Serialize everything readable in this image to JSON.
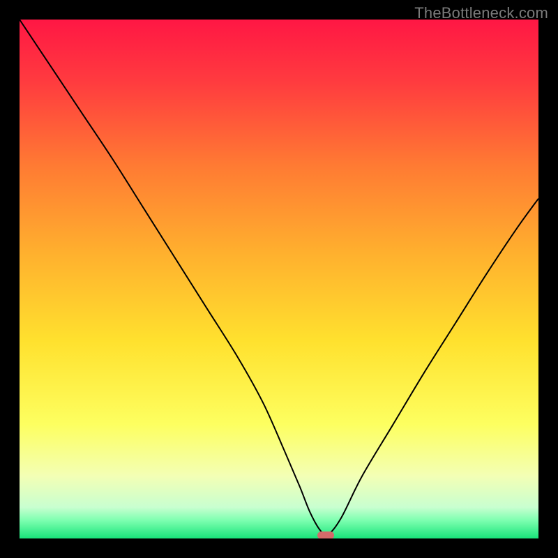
{
  "watermark": {
    "text": "TheBottleneck.com"
  },
  "chart_data": {
    "type": "line",
    "title": "",
    "xlabel": "",
    "ylabel": "",
    "xlim": [
      0,
      100
    ],
    "ylim": [
      0,
      100
    ],
    "grid": false,
    "legend": false,
    "background": {
      "type": "vertical-gradient",
      "stops": [
        {
          "offset": 0.0,
          "color": "#ff1744"
        },
        {
          "offset": 0.12,
          "color": "#ff3b3f"
        },
        {
          "offset": 0.28,
          "color": "#ff7a33"
        },
        {
          "offset": 0.45,
          "color": "#ffb02e"
        },
        {
          "offset": 0.62,
          "color": "#ffe12e"
        },
        {
          "offset": 0.78,
          "color": "#fdff60"
        },
        {
          "offset": 0.88,
          "color": "#f3ffb5"
        },
        {
          "offset": 0.94,
          "color": "#c8ffd0"
        },
        {
          "offset": 0.965,
          "color": "#7dffb0"
        },
        {
          "offset": 1.0,
          "color": "#18e47a"
        }
      ]
    },
    "series": [
      {
        "name": "bottleneck-curve",
        "color": "#000000",
        "stroke_width": 2,
        "x": [
          0,
          6,
          12,
          18,
          24,
          30,
          36,
          42,
          47,
          51,
          54,
          56,
          58,
          59.5,
          62,
          66,
          72,
          78,
          84,
          90,
          96,
          100
        ],
        "values": [
          100,
          91,
          82,
          73,
          63.5,
          54,
          44.5,
          35,
          26,
          17,
          10,
          5,
          1.5,
          0.8,
          4,
          12,
          22,
          32,
          41.5,
          51,
          60,
          65.5
        ]
      }
    ],
    "marker": {
      "name": "optimum-marker",
      "x_center": 59.0,
      "y_center": 0.6,
      "width_x_units": 3.2,
      "height_y_units": 1.6,
      "color": "#d46a6a"
    }
  }
}
